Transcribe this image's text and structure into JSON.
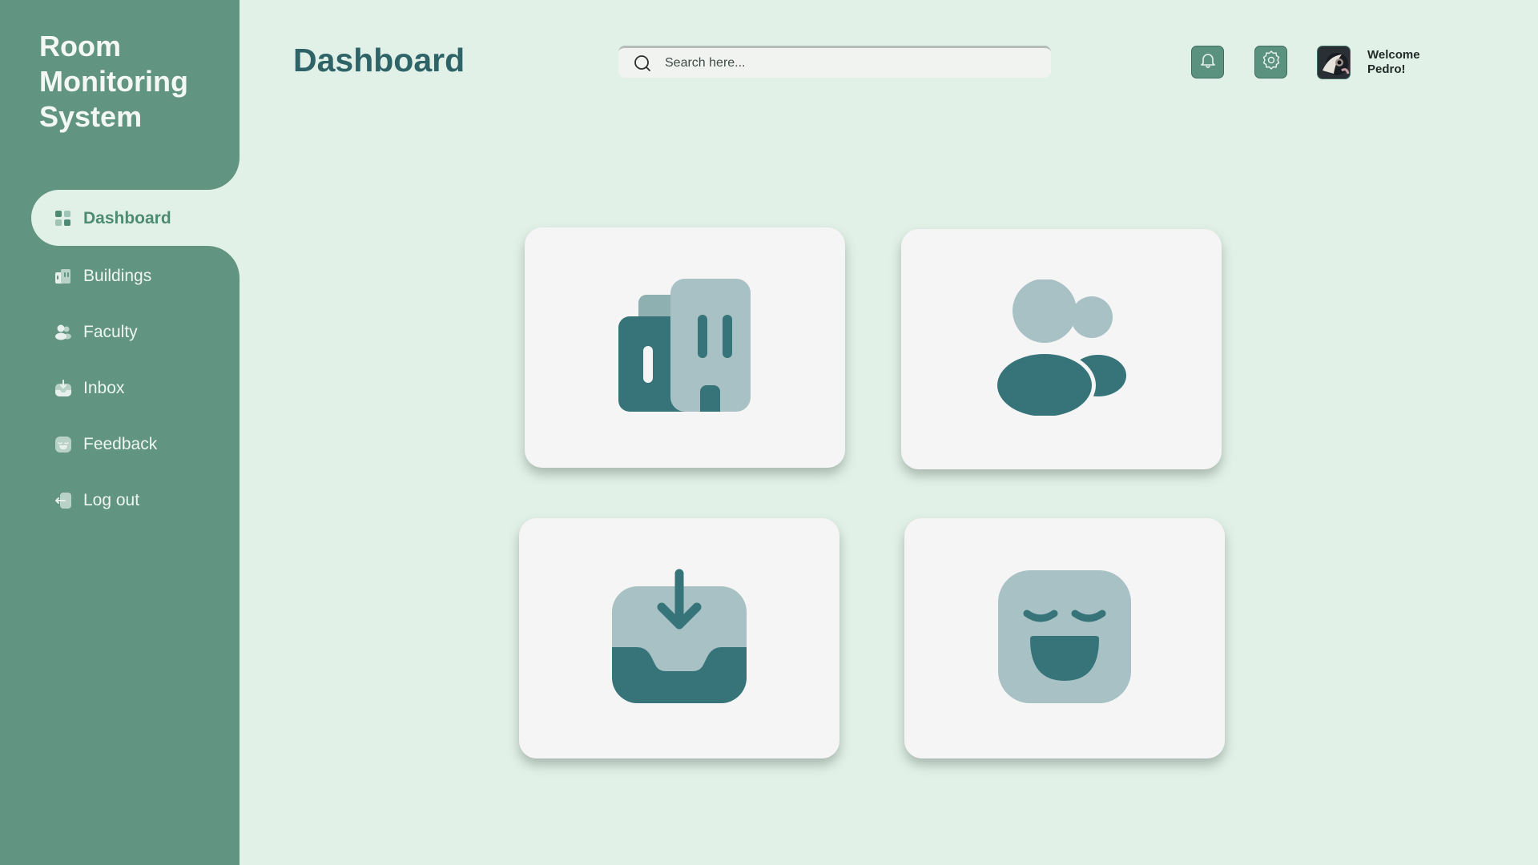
{
  "app_title": "Room Monitoring System",
  "page_title": "Dashboard",
  "search": {
    "placeholder": "Search here..."
  },
  "user": {
    "welcome_line1": "Welcome",
    "welcome_line2": "Pedro!"
  },
  "sidebar": {
    "items": [
      {
        "label": "Dashboard",
        "icon": "dashboard-grid-icon",
        "active": true
      },
      {
        "label": "Buildings",
        "icon": "building-icon",
        "active": false
      },
      {
        "label": "Faculty",
        "icon": "users-icon",
        "active": false
      },
      {
        "label": "Inbox",
        "icon": "inbox-download-icon",
        "active": false
      },
      {
        "label": "Feedback",
        "icon": "smiley-icon",
        "active": false
      },
      {
        "label": "Log out",
        "icon": "logout-icon",
        "active": false
      }
    ]
  },
  "header_icons": [
    "bell-icon",
    "gear-icon"
  ],
  "cards": [
    {
      "icon": "building-icon"
    },
    {
      "icon": "users-icon"
    },
    {
      "icon": "inbox-download-icon"
    },
    {
      "icon": "smiley-icon"
    }
  ],
  "colors": {
    "sidebar": "#629482",
    "background": "#e2f1e8",
    "accent_dark": "#36747a",
    "accent_light": "#a7c1c4",
    "card": "#f5f5f5"
  }
}
